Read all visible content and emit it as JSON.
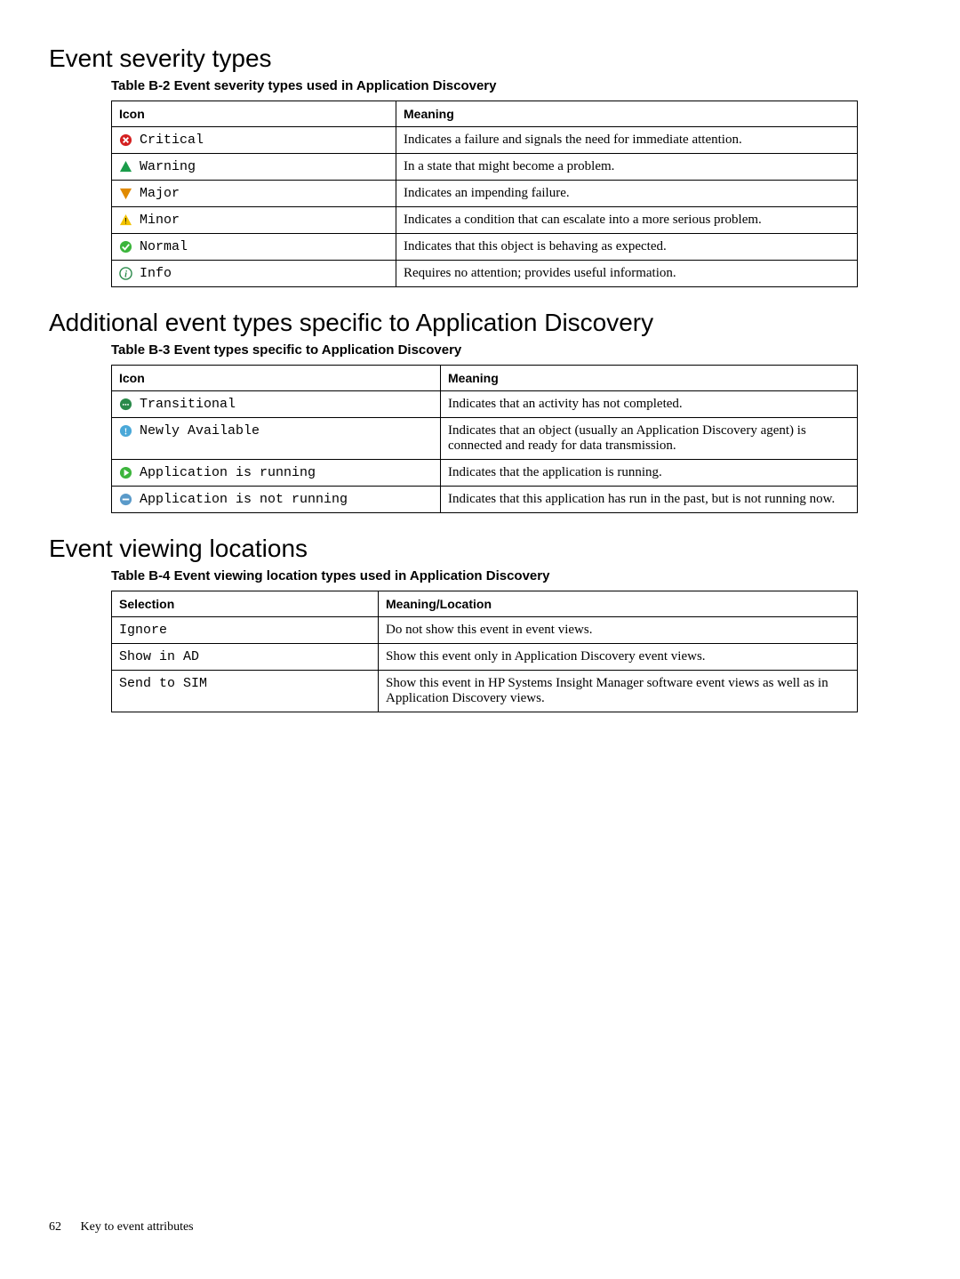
{
  "sections": {
    "severity": {
      "heading": "Event severity types",
      "caption": "Table B-2 Event severity types used in Application Discovery",
      "col1": "Icon",
      "col2": "Meaning",
      "rows": [
        {
          "label": "Critical",
          "meaning": "Indicates a failure and signals the need for immediate attention."
        },
        {
          "label": "Warning",
          "meaning": "In a state that might become a problem."
        },
        {
          "label": "Major",
          "meaning": "Indicates an impending failure."
        },
        {
          "label": "Minor",
          "meaning": "Indicates a condition that can escalate into a more serious problem."
        },
        {
          "label": "Normal",
          "meaning": "Indicates that this object is behaving as expected."
        },
        {
          "label": "Info",
          "meaning": "Requires no attention; provides useful information."
        }
      ]
    },
    "additional": {
      "heading": "Additional event types specific to Application Discovery",
      "caption": "Table B-3 Event types specific to Application Discovery",
      "col1": "Icon",
      "col2": "Meaning",
      "rows": [
        {
          "label": "Transitional",
          "meaning": "Indicates that an activity has not completed."
        },
        {
          "label": "Newly Available",
          "meaning": "Indicates that an object (usually an Application Discovery agent) is connected and ready for data transmission."
        },
        {
          "label": "Application is running",
          "meaning": "Indicates that the application is running."
        },
        {
          "label": "Application is not running",
          "meaning": "Indicates that this application has run in the past, but is not running now."
        }
      ]
    },
    "viewing": {
      "heading": "Event viewing locations",
      "caption": "Table B-4 Event viewing location types used in Application Discovery",
      "col1": "Selection",
      "col2": "Meaning/Location",
      "rows": [
        {
          "label": "Ignore",
          "meaning": "Do not show this event in event views."
        },
        {
          "label": "Show in AD",
          "meaning": "Show this event only in Application Discovery event views."
        },
        {
          "label": "Send to SIM",
          "meaning": "Show this event in HP Systems Insight Manager software event views as well as in Application Discovery views."
        }
      ]
    }
  },
  "footer": {
    "page": "62",
    "title": "Key to event attributes"
  }
}
